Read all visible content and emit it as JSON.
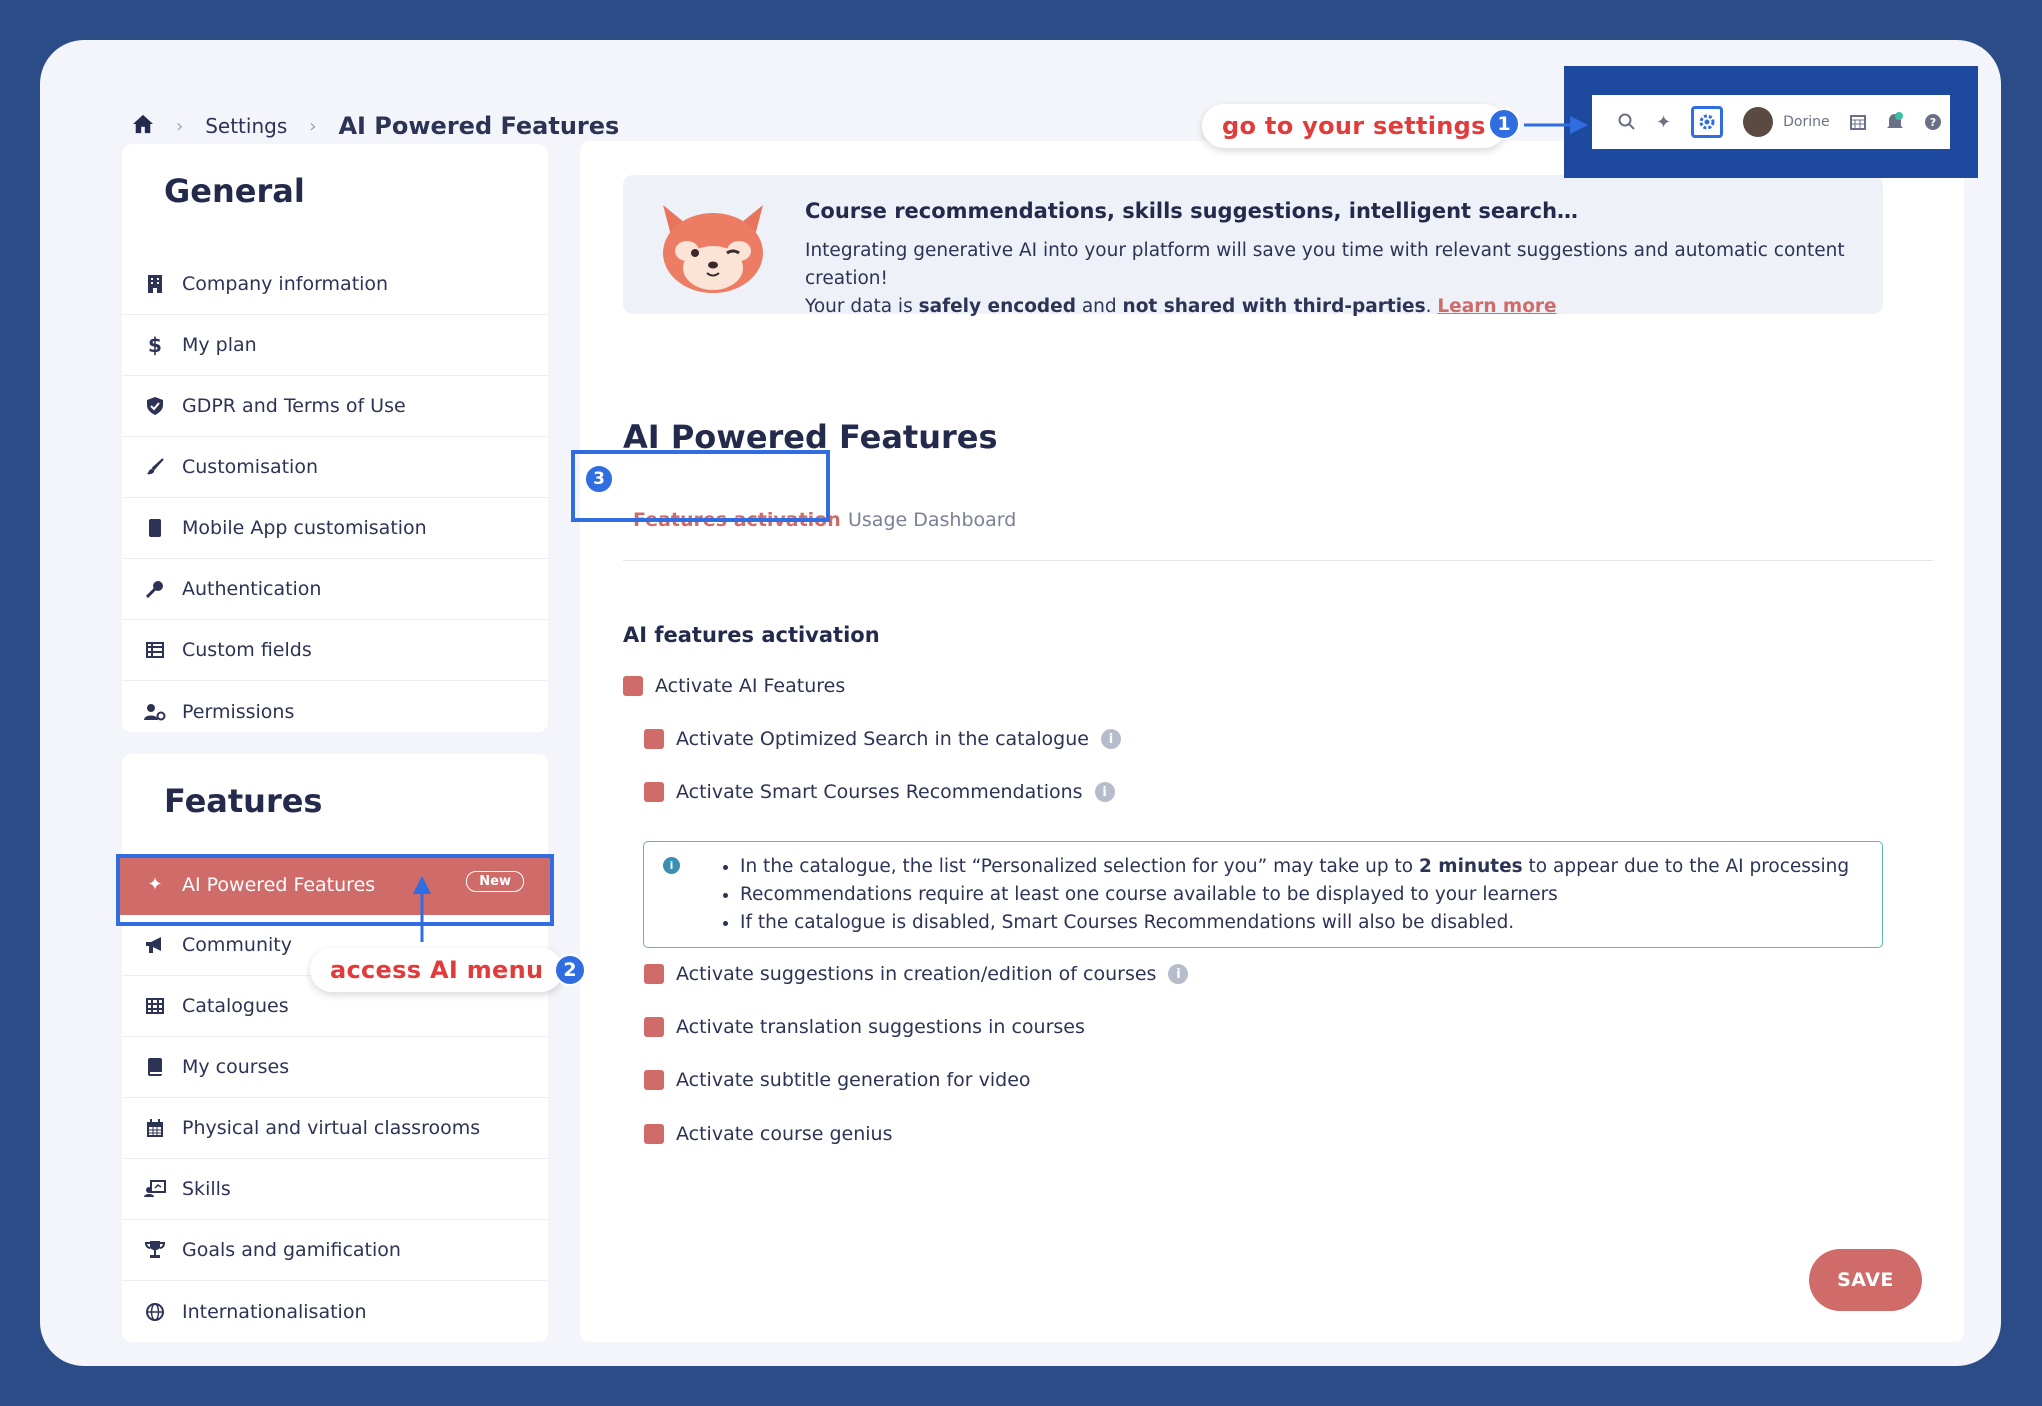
{
  "breadcrumb": {
    "home_icon": "home-icon",
    "settings": "Settings",
    "current": "AI Powered Features"
  },
  "sidebar": {
    "general_title": "General",
    "general_items": [
      {
        "label": "Company information",
        "icon": "building-icon"
      },
      {
        "label": "My plan",
        "icon": "dollar-icon"
      },
      {
        "label": "GDPR and Terms of Use",
        "icon": "shield-icon"
      },
      {
        "label": "Customisation",
        "icon": "brush-icon"
      },
      {
        "label": "Mobile App customisation",
        "icon": "mobile-icon"
      },
      {
        "label": "Authentication",
        "icon": "key-icon"
      },
      {
        "label": "Custom fields",
        "icon": "table-icon"
      },
      {
        "label": "Permissions",
        "icon": "user-cog-icon"
      }
    ],
    "features_title": "Features",
    "features_items": [
      {
        "label": "AI Powered Features",
        "icon": "sparkles-icon",
        "badge": "New",
        "active": true
      },
      {
        "label": "Community",
        "icon": "megaphone-icon"
      },
      {
        "label": "Catalogues",
        "icon": "grid-icon"
      },
      {
        "label": "My courses",
        "icon": "book-icon"
      },
      {
        "label": "Physical and virtual classrooms",
        "icon": "calendar-icon"
      },
      {
        "label": "Skills",
        "icon": "skills-icon"
      },
      {
        "label": "Goals and gamification",
        "icon": "trophy-icon"
      },
      {
        "label": "Internationalisation",
        "icon": "globe-icon"
      }
    ]
  },
  "banner": {
    "title": "Course recommendations, skills suggestions, intelligent search…",
    "line1": "Integrating generative AI into your platform will save you time with relevant suggestions and automatic content creation!",
    "line2_a": "Your data is ",
    "line2_b": "safely encoded",
    "line2_c": " and ",
    "line2_d": "not shared with third-parties",
    "line2_e": ". ",
    "learn_more": "Learn more"
  },
  "main": {
    "title": "AI Powered Features",
    "tabs": [
      {
        "label": "Features activation",
        "active": true
      },
      {
        "label": "Usage Dashboard",
        "active": false
      }
    ],
    "section_title": "AI features activation",
    "options": [
      {
        "label": "Activate AI Features",
        "checked": true,
        "info": false
      },
      {
        "label": "Activate Optimized Search in the catalogue",
        "checked": true,
        "info": true
      },
      {
        "label": "Activate Smart Courses Recommendations",
        "checked": true,
        "info": true
      },
      {
        "label": "Activate suggestions in creation/edition of courses",
        "checked": true,
        "info": true
      },
      {
        "label": "Activate translation suggestions in courses",
        "checked": true,
        "info": false
      },
      {
        "label": "Activate subtitle generation for video",
        "checked": true,
        "info": false
      },
      {
        "label": "Activate course genius",
        "checked": true,
        "info": false
      }
    ],
    "info_box": {
      "item1_a": "In the catalogue, the list “Personalized selection for you” may take up to ",
      "item1_b": "2 minutes",
      "item1_c": " to appear due to the AI processing",
      "item2": "Recommendations require at least one course available to be displayed to your learners",
      "item3": "If the catalogue is disabled, Smart Courses Recommendations will also be disabled."
    },
    "save_label": "SAVE"
  },
  "topbar": {
    "user_name": "Dorine",
    "icons": [
      "search-icon",
      "sparkles-icon",
      "gear-icon",
      "avatar",
      "calendar-icon",
      "bell-icon",
      "help-icon"
    ]
  },
  "annotations": {
    "callout1": "go to your settings",
    "callout2": "access AI menu",
    "step1": "1",
    "step2": "2",
    "step3": "3"
  },
  "colors": {
    "accent": "#cf6b68",
    "highlight": "#2f6de0",
    "background": "#2b4c86"
  }
}
